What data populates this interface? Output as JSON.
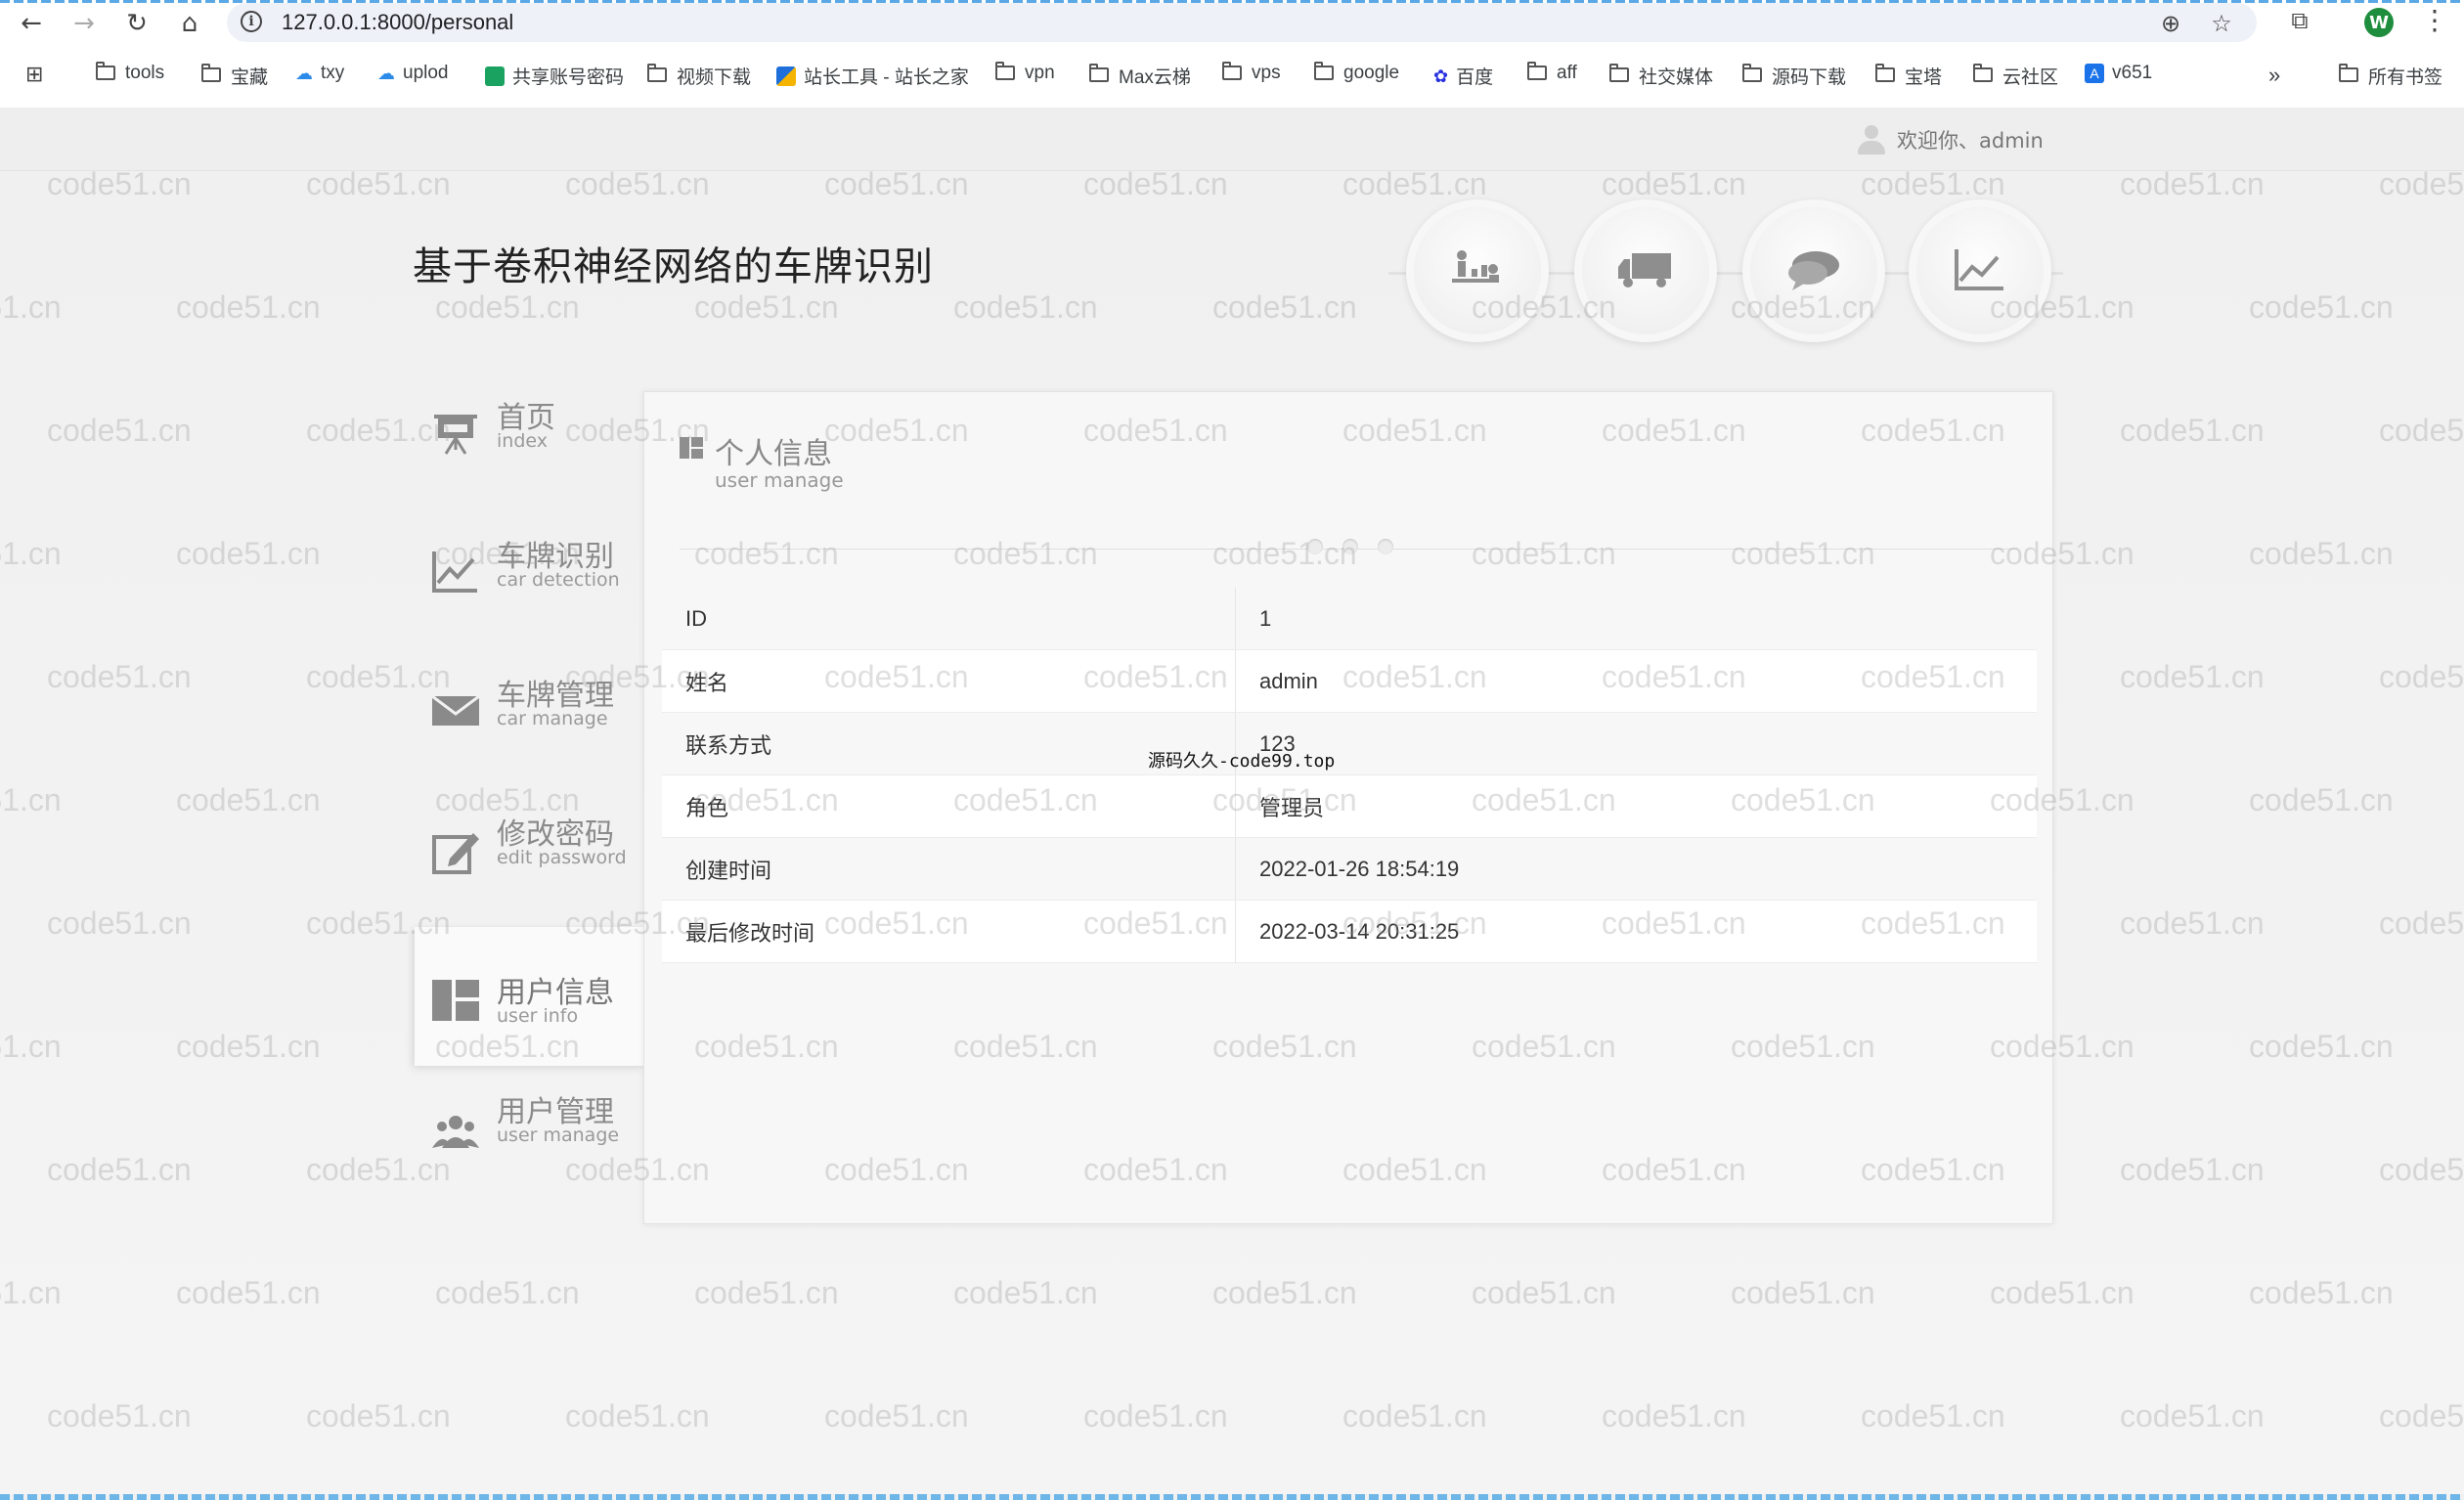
{
  "browser": {
    "url": "127.0.0.1:8000/personal",
    "profile_initial": "W",
    "bookmarks": [
      {
        "label": "tools",
        "icon": "folder-icon"
      },
      {
        "label": "宝藏",
        "icon": "folder-icon"
      },
      {
        "label": "txy",
        "icon": "cloud-icon"
      },
      {
        "label": "uplod",
        "icon": "cloud-icon"
      },
      {
        "label": "共享账号密码",
        "icon": "sheet-icon"
      },
      {
        "label": "视频下载",
        "icon": "folder-icon"
      },
      {
        "label": "站长工具 - 站长之家",
        "icon": "site-icon"
      },
      {
        "label": "vpn",
        "icon": "folder-icon"
      },
      {
        "label": "Max云梯",
        "icon": "folder-icon"
      },
      {
        "label": "vps",
        "icon": "folder-icon"
      },
      {
        "label": "google",
        "icon": "folder-icon"
      },
      {
        "label": "百度",
        "icon": "baidu-paw-icon"
      },
      {
        "label": "aff",
        "icon": "folder-icon"
      },
      {
        "label": "社交媒体",
        "icon": "folder-icon"
      },
      {
        "label": "源码下载",
        "icon": "folder-icon"
      },
      {
        "label": "宝塔",
        "icon": "folder-icon"
      },
      {
        "label": "云社区",
        "icon": "folder-icon"
      },
      {
        "label": "v651",
        "icon": "v-logo-icon"
      }
    ],
    "overflow": "»",
    "all_bookmarks": "所有书签"
  },
  "header": {
    "welcome": "欢迎你、admin",
    "site_title": "基于卷积神经网络的车牌识别"
  },
  "top_icons": [
    "users-chart-icon",
    "truck-icon",
    "chat-bubbles-icon",
    "line-chart-icon"
  ],
  "sidebar": {
    "items": [
      {
        "zh": "首页",
        "en": "index",
        "icon": "presentation-icon"
      },
      {
        "zh": "车牌识别",
        "en": "car detection",
        "icon": "line-chart-icon"
      },
      {
        "zh": "车牌管理",
        "en": "car manage",
        "icon": "envelope-icon"
      },
      {
        "zh": "修改密码",
        "en": "edit password",
        "icon": "edit-icon"
      },
      {
        "zh": "用户信息",
        "en": "user info",
        "icon": "dashboard-icon",
        "active": true
      },
      {
        "zh": "用户管理",
        "en": "user manage",
        "icon": "users-icon"
      }
    ]
  },
  "panel": {
    "title": "个人信息",
    "subtitle": "user manage",
    "rows": [
      {
        "label": "ID",
        "value": "1"
      },
      {
        "label": "姓名",
        "value": "admin"
      },
      {
        "label": "联系方式",
        "value": "123"
      },
      {
        "label": "角色",
        "value": "管理员"
      },
      {
        "label": "创建时间",
        "value": "2022-01-26 18:54:19"
      },
      {
        "label": "最后修改时间",
        "value": "2022-03-14 20:31:25"
      }
    ]
  },
  "overlay_text": "源码久久-code99.top",
  "watermark": "code51.cn",
  "colors": {
    "page_bg": "#f1f1f1",
    "panel_bg": "#f7f7f7",
    "nav_text": "#8a8a8a",
    "profile_green": "#1e8e3e"
  }
}
